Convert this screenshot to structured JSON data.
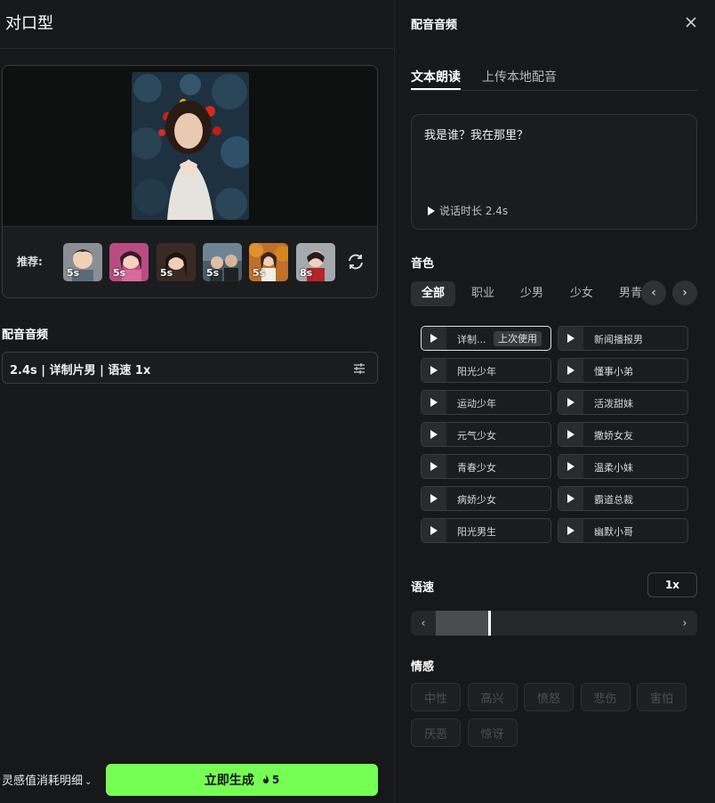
{
  "app": {
    "title": "对口型"
  },
  "preview": {
    "recommend_label": "推荐:",
    "thumbs": [
      {
        "duration": "5s",
        "icon": "avatar-boy-3d"
      },
      {
        "duration": "5s",
        "icon": "avatar-girl-pink"
      },
      {
        "duration": "5s",
        "icon": "avatar-girl-portrait"
      },
      {
        "duration": "5s",
        "icon": "avatar-couple"
      },
      {
        "duration": "5s",
        "icon": "avatar-girl-autumn"
      },
      {
        "duration": "8s",
        "icon": "avatar-girl-red"
      }
    ]
  },
  "audio_section": {
    "label": "配音音频",
    "value": "2.4s | 详制片男 | 语速 1x"
  },
  "footer": {
    "consumption_link": "灵感值消耗明细",
    "generate_label": "立即生成",
    "cost": "5"
  },
  "panel": {
    "title": "配音音频",
    "tabs": [
      {
        "label": "文本朗读",
        "active": true
      },
      {
        "label": "上传本地配音",
        "active": false
      }
    ],
    "text": {
      "content": "我是谁？我在那里？",
      "duration_label": "说话时长 2.4s"
    },
    "voice": {
      "label": "音色",
      "categories": [
        "全部",
        "职业",
        "少男",
        "少女",
        "男青"
      ],
      "items": [
        {
          "name": "详制...",
          "badge": "上次使用",
          "selected": true
        },
        {
          "name": "新闻播报男"
        },
        {
          "name": "阳光少年"
        },
        {
          "name": "懂事小弟"
        },
        {
          "name": "运动少年"
        },
        {
          "name": "活泼甜妹"
        },
        {
          "name": "元气少女"
        },
        {
          "name": "撒娇女友"
        },
        {
          "name": "青春少女"
        },
        {
          "name": "温柔小妹"
        },
        {
          "name": "病娇少女"
        },
        {
          "name": "霸道总裁"
        },
        {
          "name": "阳光男生"
        },
        {
          "name": "幽默小哥"
        }
      ]
    },
    "speed": {
      "label": "语速",
      "value": "1x",
      "level": 0.22
    },
    "emotion": {
      "label": "情感",
      "options": [
        "中性",
        "高兴",
        "愤怒",
        "悲伤",
        "害怕",
        "厌恶",
        "惊讶"
      ]
    }
  },
  "colors": {
    "accent_green": "#75ff54",
    "background": "#17181a"
  }
}
